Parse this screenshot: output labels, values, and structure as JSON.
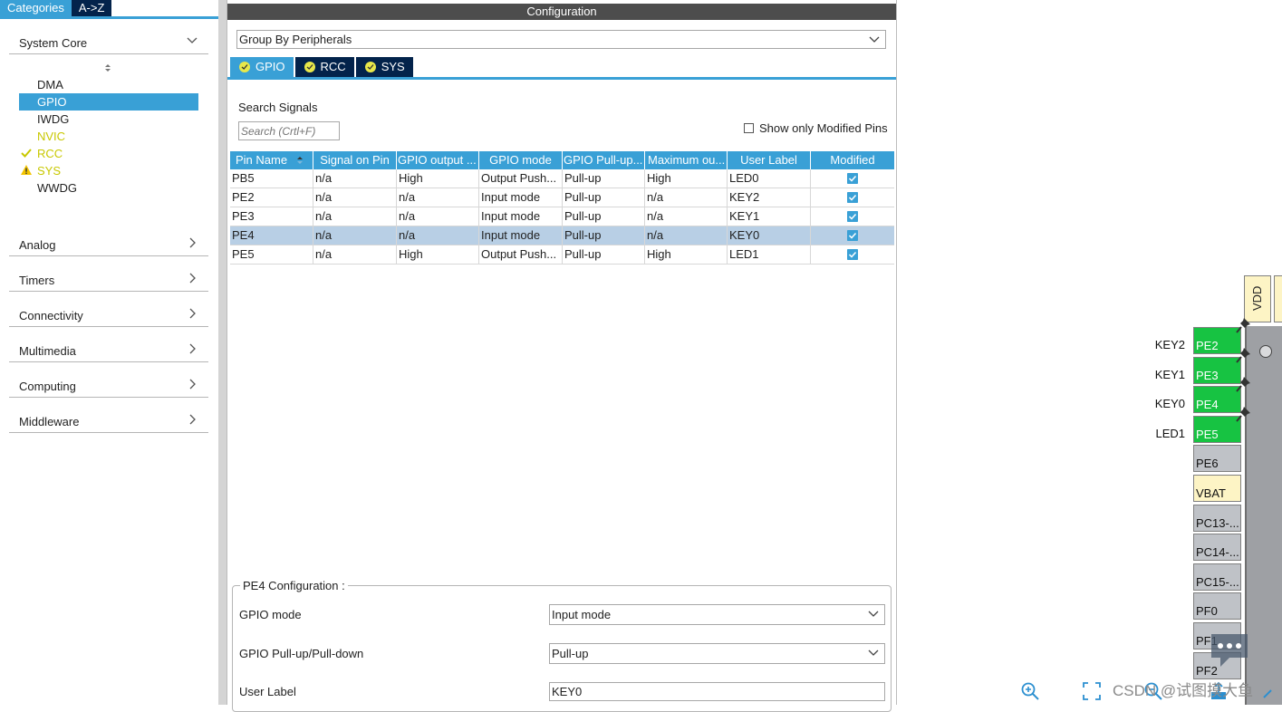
{
  "left_panel": {
    "tabs": [
      "Categories",
      "A->Z"
    ],
    "categories": [
      {
        "label": "System Core",
        "expanded": true
      },
      {
        "label": "Analog"
      },
      {
        "label": "Timers"
      },
      {
        "label": "Connectivity"
      },
      {
        "label": "Multimedia"
      },
      {
        "label": "Computing"
      },
      {
        "label": "Middleware"
      }
    ],
    "system_core_items": [
      {
        "label": "DMA",
        "state": "normal"
      },
      {
        "label": "GPIO",
        "state": "selected"
      },
      {
        "label": "IWDG",
        "state": "normal"
      },
      {
        "label": "NVIC",
        "state": "yellow"
      },
      {
        "label": "RCC",
        "state": "check"
      },
      {
        "label": "SYS",
        "state": "warning"
      },
      {
        "label": "WWDG",
        "state": "normal"
      }
    ]
  },
  "config": {
    "title": "Configuration",
    "group_by": "Group By Peripherals",
    "tabs": [
      "GPIO",
      "RCC",
      "SYS"
    ],
    "search_label": "Search Signals",
    "search_placeholder": "Search (Crtl+F)",
    "show_modified_label": "Show only Modified Pins",
    "table": {
      "headers": [
        "Pin Name",
        "Signal on Pin",
        "GPIO output ...",
        "GPIO mode",
        "GPIO Pull-up...",
        "Maximum ou...",
        "User Label",
        "Modified"
      ],
      "rows": [
        [
          "PB5",
          "n/a",
          "High",
          "Output Push...",
          "Pull-up",
          "High",
          "LED0"
        ],
        [
          "PE2",
          "n/a",
          "n/a",
          "Input mode",
          "Pull-up",
          "n/a",
          "KEY2"
        ],
        [
          "PE3",
          "n/a",
          "n/a",
          "Input mode",
          "Pull-up",
          "n/a",
          "KEY1"
        ],
        [
          "PE4",
          "n/a",
          "n/a",
          "Input mode",
          "Pull-up",
          "n/a",
          "KEY0"
        ],
        [
          "PE5",
          "n/a",
          "High",
          "Output Push...",
          "Pull-up",
          "High",
          "LED1"
        ]
      ],
      "selected_row": 3
    },
    "pin_config": {
      "title": "PE4 Configuration :",
      "fields": [
        {
          "label": "GPIO mode",
          "value": "Input mode"
        },
        {
          "label": "GPIO Pull-up/Pull-down",
          "value": "Pull-up"
        },
        {
          "label": "User Label",
          "value": "KEY0"
        }
      ]
    }
  },
  "pinout": {
    "top_pin": "VDD",
    "pins": [
      {
        "name": "PE2",
        "label": "KEY2",
        "color": "green"
      },
      {
        "name": "PE3",
        "label": "KEY1",
        "color": "green"
      },
      {
        "name": "PE4",
        "label": "KEY0",
        "color": "green"
      },
      {
        "name": "PE5",
        "label": "LED1",
        "color": "green"
      },
      {
        "name": "PE6",
        "label": "",
        "color": "grey"
      },
      {
        "name": "VBAT",
        "label": "",
        "color": "yellow"
      },
      {
        "name": "PC13-...",
        "label": "",
        "color": "grey"
      },
      {
        "name": "PC14-...",
        "label": "",
        "color": "grey"
      },
      {
        "name": "PC15-...",
        "label": "",
        "color": "grey"
      },
      {
        "name": "PF0",
        "label": "",
        "color": "grey"
      },
      {
        "name": "PF1",
        "label": "",
        "color": "grey"
      },
      {
        "name": "PF2",
        "label": "",
        "color": "grey"
      }
    ],
    "watermark": "CSDN @试图摸大鱼"
  },
  "colors": {
    "accent": "#39a0d6",
    "dark_tab": "#03234b",
    "pin_green": "#17c342",
    "pin_grey": "#bfc2c7",
    "pin_power": "#fdf4c5"
  }
}
